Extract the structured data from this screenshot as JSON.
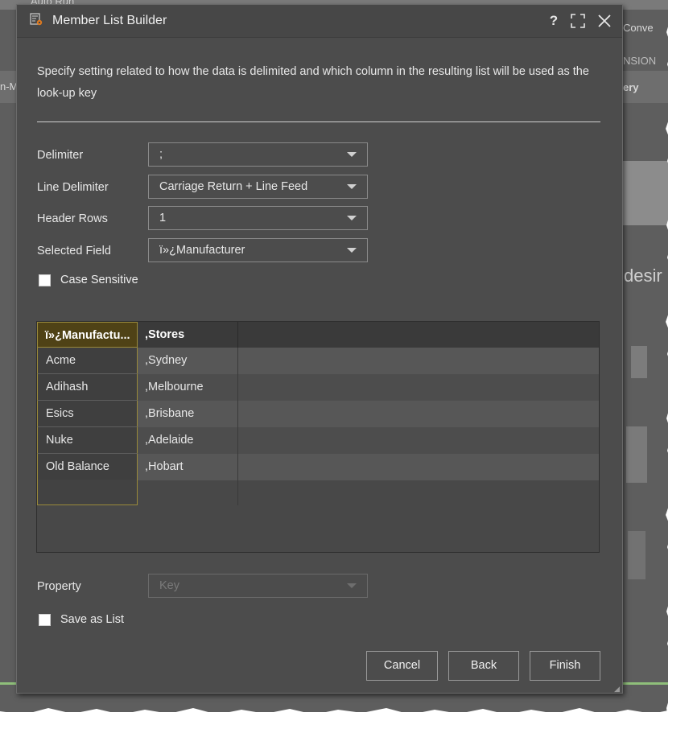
{
  "background": {
    "fragments": [
      "Auto Run",
      "n-M",
      "Conve",
      "NSION",
      "ery",
      "desir"
    ]
  },
  "dialog": {
    "title": "Member List Builder",
    "help_label": "?",
    "instructions": "Specify setting related to how the data is delimited and which column in the resulting list will be used as the look-up key",
    "fields": {
      "delimiter": {
        "label": "Delimiter",
        "value": ";"
      },
      "line_delimiter": {
        "label": "Line Delimiter",
        "value": "Carriage Return + Line Feed"
      },
      "header_rows": {
        "label": "Header Rows",
        "value": "1"
      },
      "selected_field": {
        "label": "Selected Field",
        "value": "ï»¿Manufacturer"
      }
    },
    "case_sensitive": {
      "label": "Case Sensitive",
      "checked": false
    },
    "grid": {
      "columns": [
        "ï»¿Manufactu...",
        ",Stores"
      ],
      "rows": [
        [
          "Acme",
          ",Sydney"
        ],
        [
          "Adihash",
          ",Melbourne"
        ],
        [
          "Esics",
          ",Brisbane"
        ],
        [
          "Nuke",
          ",Adelaide"
        ],
        [
          "Old Balance",
          ",Hobart"
        ]
      ]
    },
    "property": {
      "label": "Property",
      "value": "Key",
      "disabled": true
    },
    "save_as_list": {
      "label": "Save as List",
      "checked": false
    },
    "buttons": {
      "cancel": "Cancel",
      "back": "Back",
      "finish": "Finish"
    }
  },
  "colors": {
    "dialog_bg": "#4c4c4c",
    "selected_column_header": "#4f4216",
    "selected_column_border": "#9a8a3a",
    "text": "#e8e8e8"
  }
}
